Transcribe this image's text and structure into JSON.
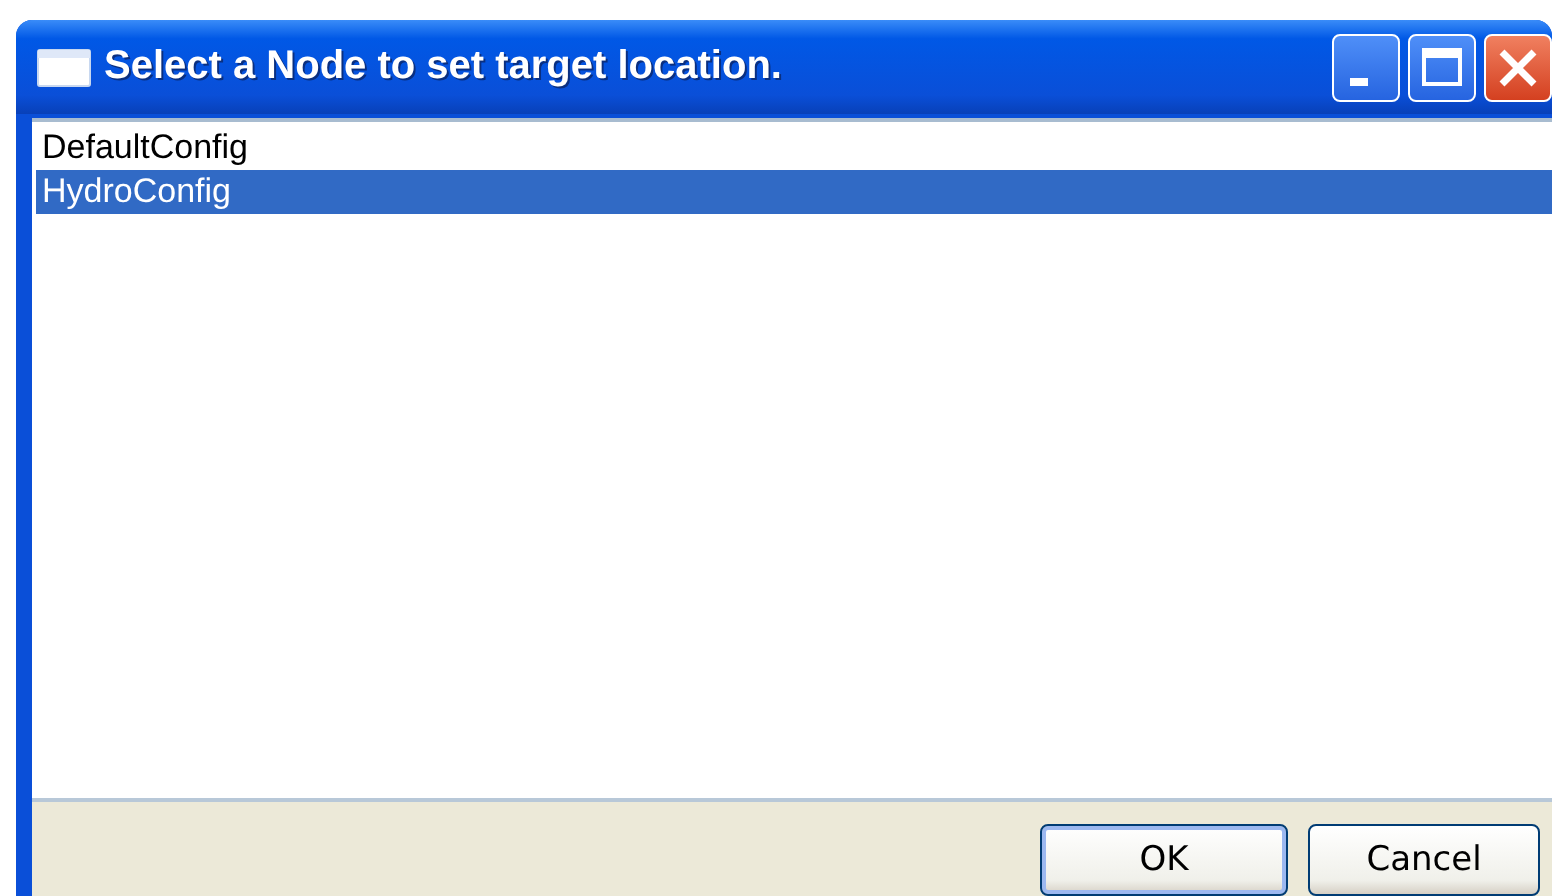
{
  "window": {
    "title": "Select a Node to set target location."
  },
  "list": {
    "items": [
      {
        "label": "DefaultConfig",
        "selected": false
      },
      {
        "label": "HydroConfig",
        "selected": true
      }
    ]
  },
  "buttons": [
    {
      "label": "OK",
      "kind": "default"
    },
    {
      "label": "Cancel",
      "kind": "normal"
    }
  ]
}
